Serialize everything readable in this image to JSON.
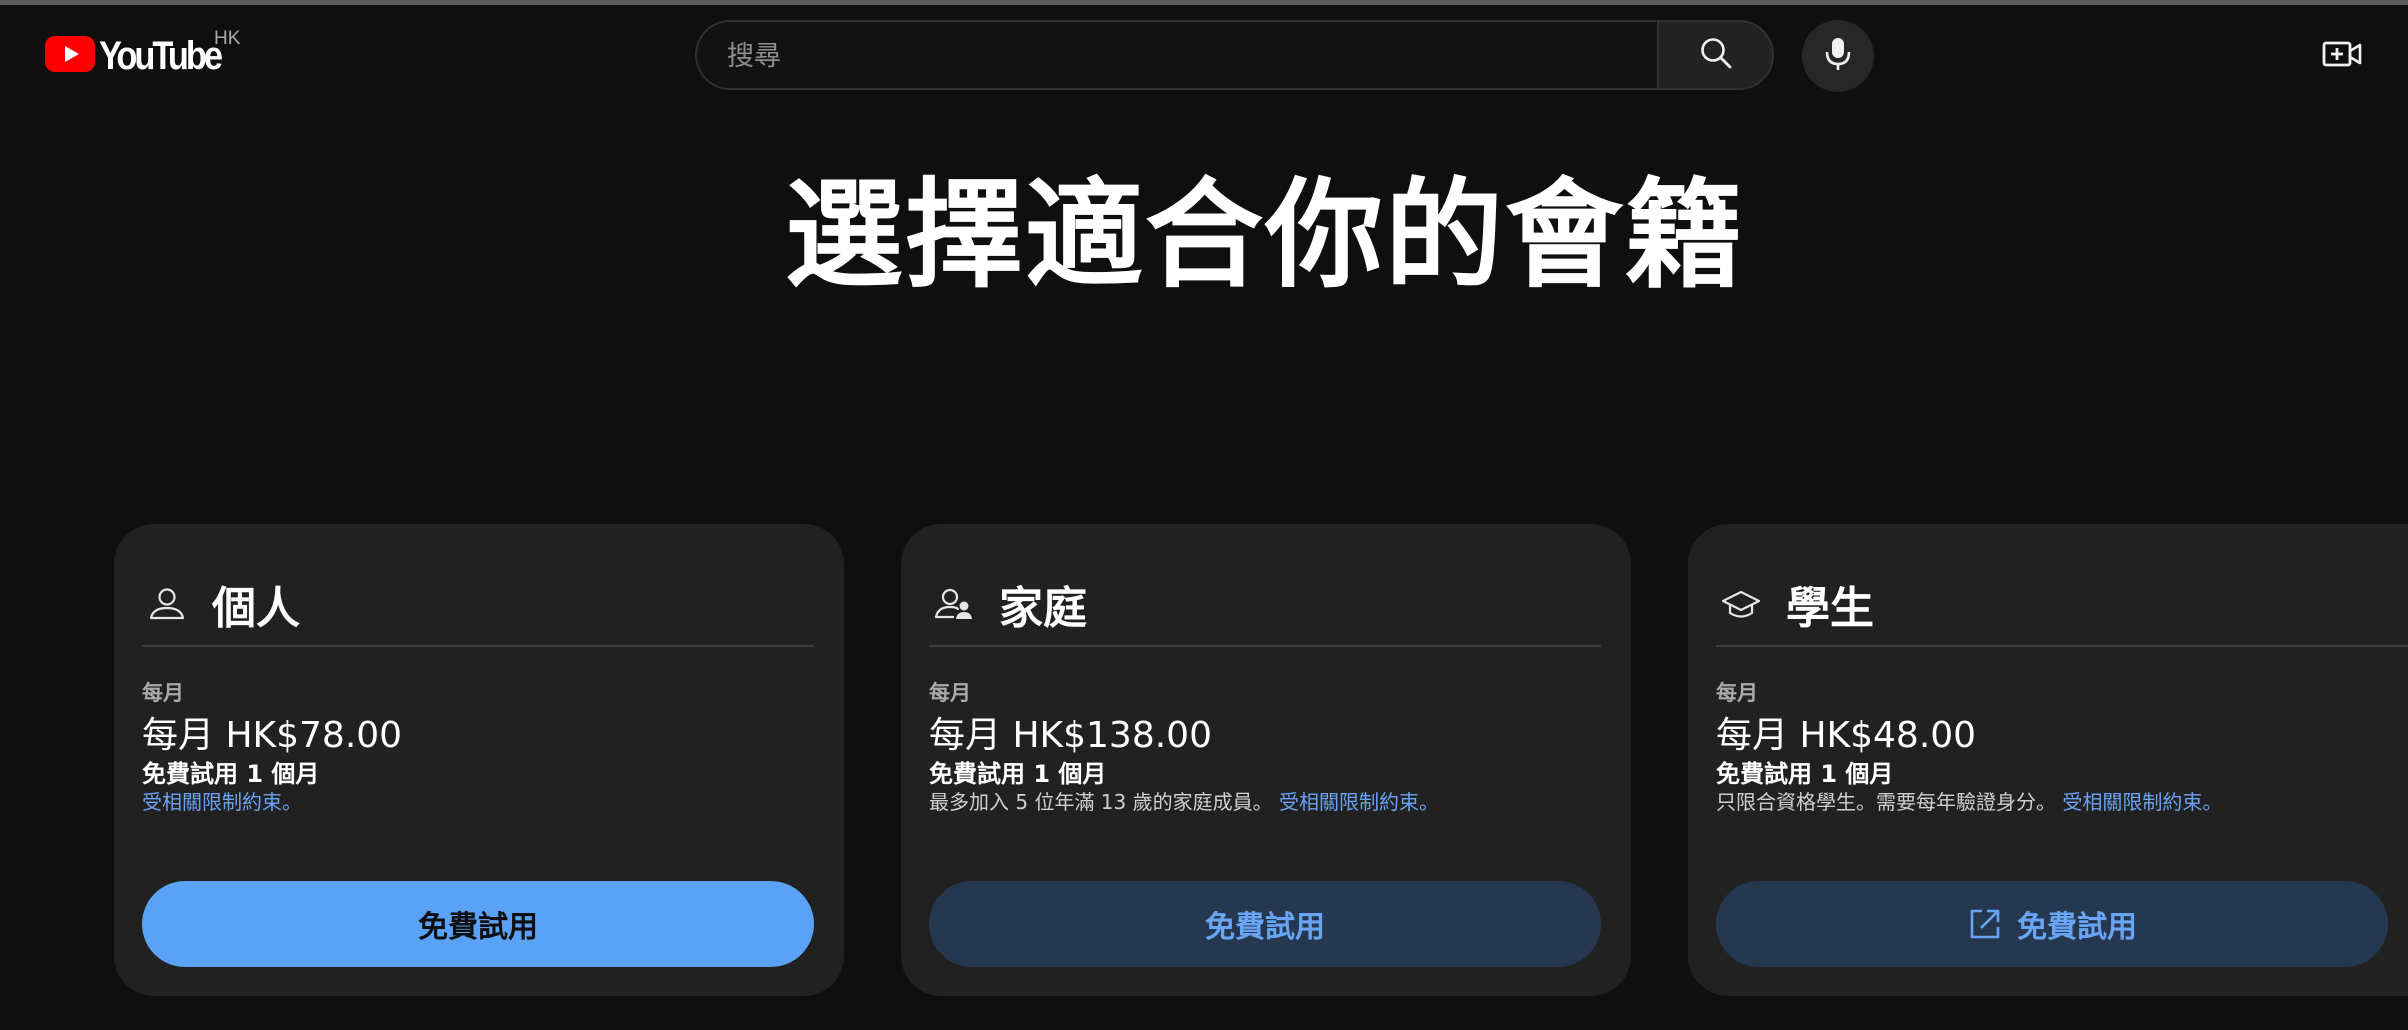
{
  "header": {
    "logo_text": "YouTube",
    "region": "HK",
    "search_placeholder": "搜尋",
    "icons": {
      "search": "search-icon",
      "mic": "mic-icon",
      "create": "create-video-icon"
    }
  },
  "page_title": "選擇適合你的會籍",
  "plans": [
    {
      "name": "個人",
      "icon": "person-icon",
      "billing_label": "每月",
      "price": "每月 HK$78.00",
      "trial": "免費試用 1 個月",
      "note": "",
      "terms_link": "受相關限制約束。",
      "cta": "免費試用"
    },
    {
      "name": "家庭",
      "icon": "family-icon",
      "billing_label": "每月",
      "price": "每月 HK$138.00",
      "trial": "免費試用 1 個月",
      "note": "最多加入 5 位年滿 13 歲的家庭成員。",
      "terms_link": "受相關限制約束。",
      "cta": "免費試用"
    },
    {
      "name": "學生",
      "icon": "graduation-cap-icon",
      "billing_label": "每月",
      "price": "每月 HK$48.00",
      "trial": "免費試用 1 個月",
      "note": "只限合資格學生。需要每年驗證身分。",
      "terms_link": "受相關限制約束。",
      "cta": "免費試用",
      "cta_icon": "open-in-new-icon"
    }
  ],
  "colors": {
    "background": "#0f0f0f",
    "card": "#212121",
    "primary_button": "#5aa2f5",
    "secondary_button": "#263850",
    "link": "#6aa3f5",
    "brand_red": "#ff0000"
  }
}
